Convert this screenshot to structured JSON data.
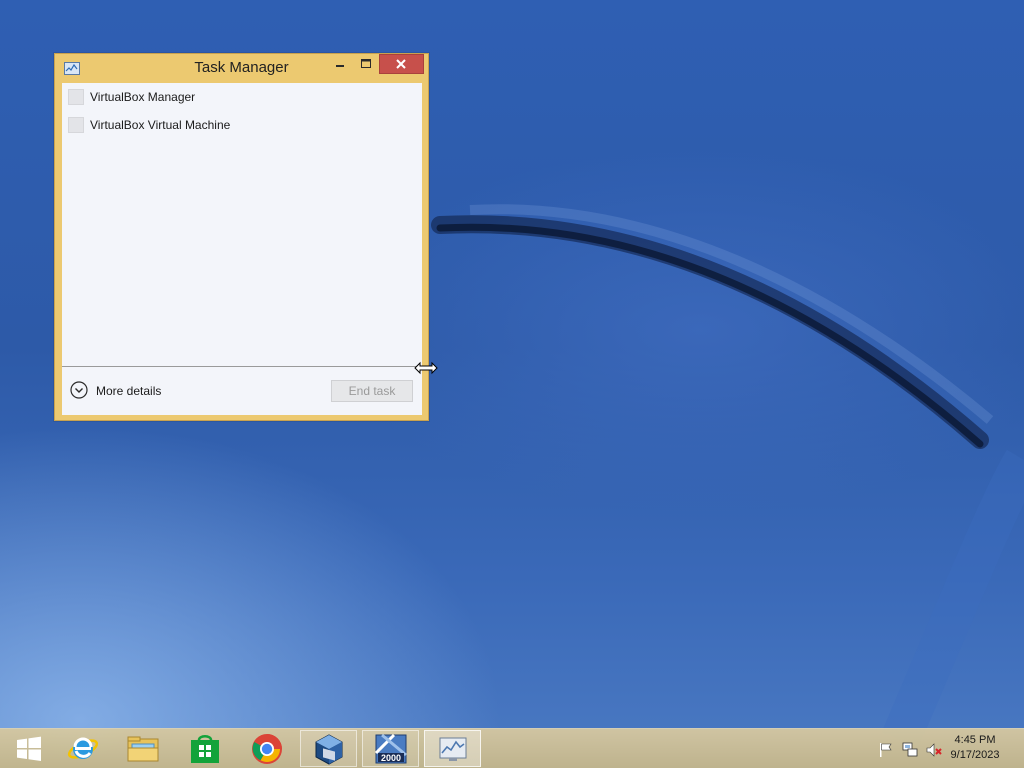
{
  "window": {
    "title": "Task Manager",
    "accent_color": "#ecc970",
    "close_color": "#c7504b"
  },
  "processes": [
    {
      "label": "VirtualBox Manager",
      "icon": "virtualbox-manager-icon"
    },
    {
      "label": "VirtualBox Virtual Machine",
      "icon": "virtualbox-vm-icon"
    }
  ],
  "footer": {
    "more_details_label": "More details",
    "end_task_label": "End task"
  },
  "taskbar": {
    "start_icon": "windows-logo-icon",
    "pinned": [
      {
        "name": "internet-explorer-icon",
        "state": "pinned"
      },
      {
        "name": "file-explorer-icon",
        "state": "pinned"
      },
      {
        "name": "store-icon",
        "state": "pinned"
      },
      {
        "name": "chrome-icon",
        "state": "pinned"
      },
      {
        "name": "virtualbox-icon",
        "state": "running"
      },
      {
        "name": "windows-2000-icon",
        "state": "running"
      },
      {
        "name": "task-manager-icon",
        "state": "active"
      }
    ]
  },
  "tray": {
    "icons": [
      "action-center-flag-icon",
      "network-icon",
      "volume-muted-icon"
    ],
    "time": "4:45 PM",
    "date": "9/17/2023"
  }
}
